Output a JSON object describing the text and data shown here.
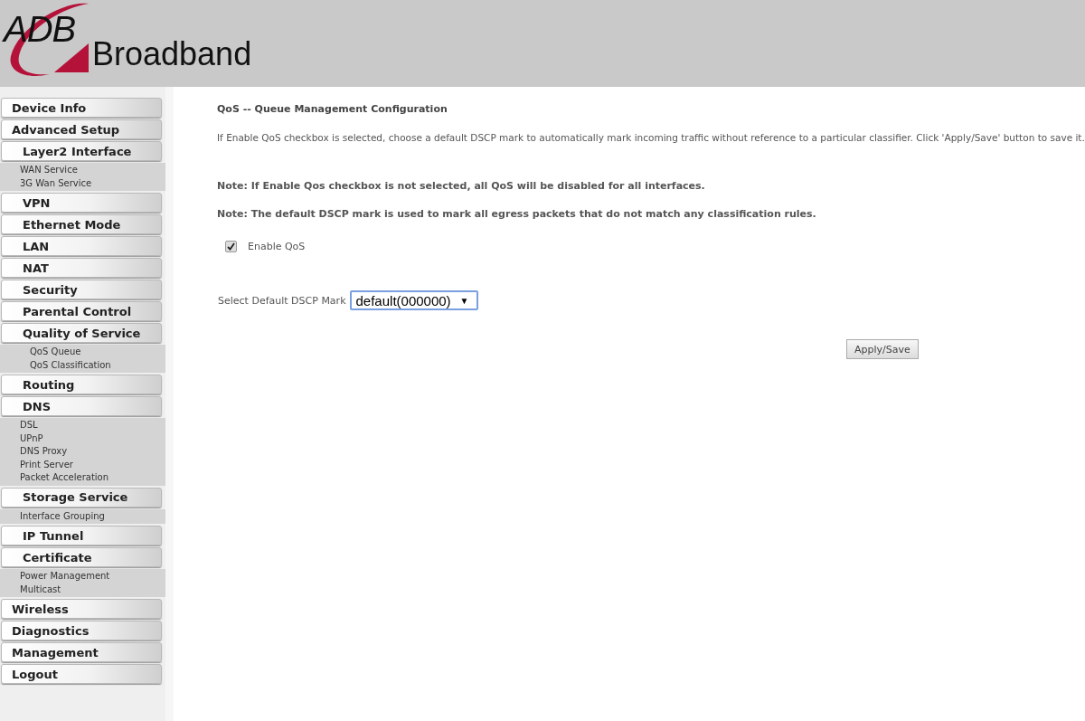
{
  "logo": {
    "mark": "ADB",
    "name": "Broadband"
  },
  "sidebar": {
    "items": [
      {
        "kind": "button",
        "label": "Device Info"
      },
      {
        "kind": "button",
        "label": "Advanced Setup",
        "children": [
          {
            "kind": "button",
            "label": "Layer2 Interface",
            "children": [
              {
                "kind": "link",
                "label": "WAN Service"
              },
              {
                "kind": "link",
                "label": "3G Wan Service"
              }
            ]
          },
          {
            "kind": "button",
            "label": "VPN"
          },
          {
            "kind": "button",
            "label": "Ethernet Mode"
          },
          {
            "kind": "button",
            "label": "LAN"
          },
          {
            "kind": "button",
            "label": "NAT"
          },
          {
            "kind": "button",
            "label": "Security"
          },
          {
            "kind": "button",
            "label": "Parental Control"
          },
          {
            "kind": "button",
            "label": "Quality of Service",
            "children": [
              {
                "kind": "sublink",
                "label": "QoS Queue"
              },
              {
                "kind": "sublink",
                "label": "QoS Classification"
              }
            ]
          },
          {
            "kind": "button",
            "label": "Routing"
          },
          {
            "kind": "button",
            "label": "DNS",
            "children": [
              {
                "kind": "link",
                "label": "DSL"
              },
              {
                "kind": "link",
                "label": "UPnP"
              },
              {
                "kind": "link",
                "label": "DNS Proxy"
              },
              {
                "kind": "link",
                "label": "Print Server"
              },
              {
                "kind": "link",
                "label": "Packet Acceleration"
              }
            ]
          },
          {
            "kind": "button",
            "label": "Storage Service",
            "children": [
              {
                "kind": "link",
                "label": "Interface Grouping"
              }
            ]
          },
          {
            "kind": "button",
            "label": "IP Tunnel"
          },
          {
            "kind": "button",
            "label": "Certificate",
            "children": [
              {
                "kind": "link",
                "label": "Power Management"
              },
              {
                "kind": "link",
                "label": "Multicast"
              }
            ]
          }
        ]
      },
      {
        "kind": "button",
        "label": "Wireless"
      },
      {
        "kind": "button",
        "label": "Diagnostics"
      },
      {
        "kind": "button",
        "label": "Management"
      },
      {
        "kind": "button",
        "label": "Logout"
      }
    ]
  },
  "main": {
    "title": "QoS -- Queue Management Configuration",
    "description": "If Enable QoS checkbox is selected, choose a default DSCP mark to automatically mark incoming traffic without reference to a particular classifier. Click 'Apply/Save' button to save it.",
    "notes": [
      "Note: If Enable Qos checkbox is not selected, all QoS will be disabled for all interfaces.",
      "Note: The default DSCP mark is used to mark all egress packets that do not match any classification rules."
    ],
    "enable_qos": {
      "label": "Enable QoS",
      "checked": true
    },
    "dscp": {
      "label": "Select Default DSCP Mark",
      "value": "default(000000)",
      "arrow": "▼"
    },
    "apply_button": "Apply/Save"
  }
}
